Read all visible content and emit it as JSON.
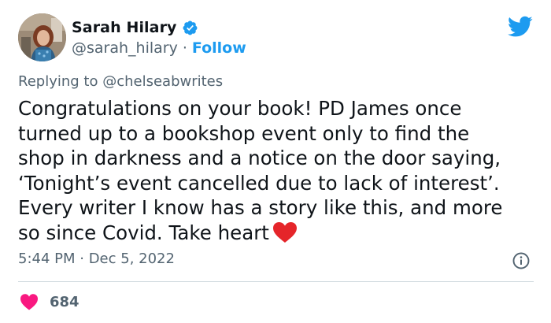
{
  "author": {
    "name": "Sarah Hilary",
    "handle": "@sarah_hilary",
    "separator": "·",
    "follow_label": "Follow"
  },
  "reply": {
    "prefix": "Replying to ",
    "mention": "@chelseabwrites"
  },
  "tweet": {
    "text": "Congratulations on your book! PD James once\nturned up to a bookshop event only to find the\nshop in darkness and a notice on the door saying,\n‘Tonight’s event cancelled due to lack of interest’.\nEvery writer I know has a story like this, and more\nso since Covid. Take heart",
    "emoji": "heart-emoji"
  },
  "meta": {
    "timestamp": "5:44 PM · Dec 5, 2022"
  },
  "engagement": {
    "likes": "684"
  },
  "icons": {
    "brand": "twitter-bird-icon",
    "verified": "verified-badge-icon",
    "info": "info-icon",
    "like": "heart-icon"
  },
  "colors": {
    "accent": "#1d9bf0",
    "like": "#f91880",
    "text": "#0f1419",
    "secondary": "#536471",
    "heart_emoji": "#e5252a"
  }
}
